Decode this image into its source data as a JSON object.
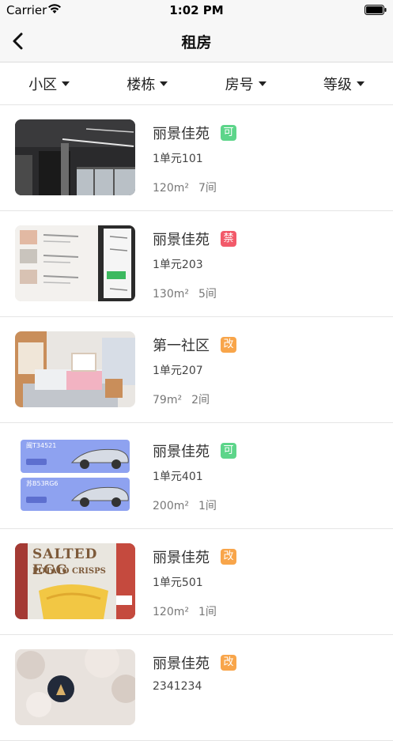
{
  "status_bar": {
    "carrier": "Carrier",
    "time": "1:02 PM"
  },
  "nav": {
    "title": "租房"
  },
  "filters": [
    {
      "label": "小区"
    },
    {
      "label": "楼栋"
    },
    {
      "label": "房号"
    },
    {
      "label": "等级"
    }
  ],
  "colors": {
    "badge_green": "#5dd58a",
    "badge_red": "#f25a6a",
    "badge_orange": "#f8a54a"
  },
  "listings": [
    {
      "name": "丽景佳苑",
      "badge": "可",
      "badge_color": "#5dd58a",
      "unit": "1单元101",
      "area": "120m²",
      "rooms": "7间",
      "image": "office-photo"
    },
    {
      "name": "丽景佳苑",
      "badge": "禁",
      "badge_color": "#f25a6a",
      "unit": "1单元203",
      "area": "130m²",
      "rooms": "5间",
      "image": "tablet-photo"
    },
    {
      "name": "第一社区",
      "badge": "改",
      "badge_color": "#f8a54a",
      "unit": "1单元207",
      "area": "79m²",
      "rooms": "2间",
      "image": "bedroom-photo"
    },
    {
      "name": "丽景佳苑",
      "badge": "可",
      "badge_color": "#5dd58a",
      "unit": "1单元401",
      "area": "200m²",
      "rooms": "1间",
      "image": "car-cards",
      "cards": [
        "闽T34521",
        "苏B53RG6"
      ]
    },
    {
      "name": "丽景佳苑",
      "badge": "改",
      "badge_color": "#f8a54a",
      "unit": "1单元501",
      "area": "120m²",
      "rooms": "1间",
      "image": "chips-photo",
      "image_text": [
        "SALTED EGG",
        "POTATO CRISPS"
      ]
    },
    {
      "name": "丽景佳苑",
      "badge": "改",
      "badge_color": "#f8a54a",
      "unit": "2341234",
      "area": "",
      "rooms": "",
      "image": "blossom-photo"
    }
  ]
}
